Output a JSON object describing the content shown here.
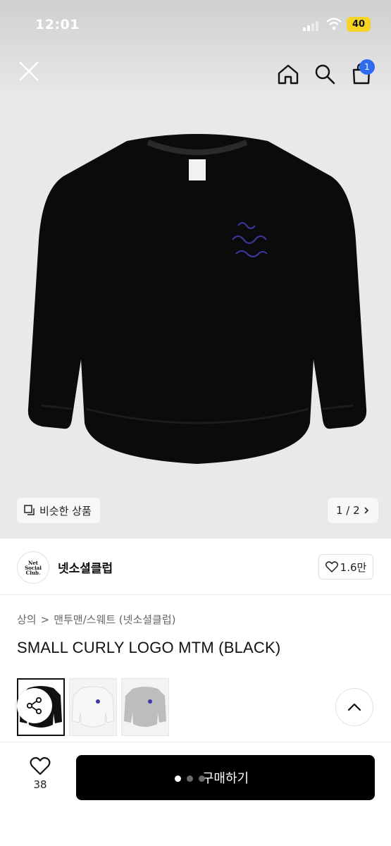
{
  "status_bar": {
    "time": "12:01",
    "battery": "40"
  },
  "top_nav": {
    "cart_count": "1"
  },
  "gallery": {
    "similar_label": "비슷한 상품",
    "pager": "1 / 2"
  },
  "brand": {
    "name": "넷소셜클럽",
    "logo_lines": [
      "Net",
      "Social",
      "Club."
    ],
    "like_count": "1.6만"
  },
  "breadcrumb": {
    "root": "상의",
    "separator": ">",
    "category": "맨투맨/스웨트 (넷소셜클럽)"
  },
  "product": {
    "title": "SMALL CURLY LOGO MTM (BLACK)",
    "color_options": [
      {
        "color": "#111111",
        "selected": true
      },
      {
        "color": "#f4f4f2",
        "selected": false
      },
      {
        "color": "#bdbdbd",
        "selected": false
      }
    ],
    "logo_color": "#3d3aa8"
  },
  "bottom_bar": {
    "heart_count": "38",
    "buy_label": "구매하기"
  }
}
